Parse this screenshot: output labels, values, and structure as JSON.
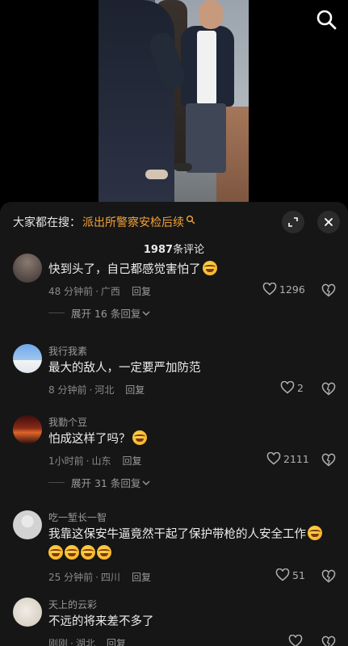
{
  "search": {
    "prefix": "大家都在搜：",
    "query": "派出所警察安检后续"
  },
  "comments_header": {
    "count": "1987",
    "suffix": "条评论"
  },
  "comments": [
    {
      "username": "",
      "text": "快到头了，自己都感觉害怕了",
      "emoji_count": 1,
      "time": "48 分钟前",
      "location": "广西",
      "reply_label": "回复",
      "likes": "1296",
      "expand_label": "展开 16 条回复"
    },
    {
      "username": "我行我素",
      "text": "最大的敌人，一定要严加防范",
      "emoji_count": 0,
      "time": "8 分钟前",
      "location": "河北",
      "reply_label": "回复",
      "likes": "2",
      "expand_label": ""
    },
    {
      "username": "我勤个豆",
      "text": "怕成这样了吗？",
      "emoji_count": 1,
      "time": "1小时前",
      "location": "山东",
      "reply_label": "回复",
      "likes": "2111",
      "expand_label": "展开 31 条回复"
    },
    {
      "username": "吃一堑长一智",
      "text": "我靠这保安牛逼竟然干起了保护带枪的人安全工作",
      "emoji_count": 5,
      "time": "25 分钟前",
      "location": "四川",
      "reply_label": "回复",
      "likes": "51",
      "expand_label": ""
    },
    {
      "username": "天上的云彩",
      "text": "不远的将来差不多了",
      "emoji_count": 0,
      "time": "刚刚",
      "location": "湖北",
      "reply_label": "回复",
      "likes": "",
      "expand_label": ""
    }
  ],
  "colors": {
    "accent": "#f2a33a",
    "sheet_bg": "#161616"
  }
}
